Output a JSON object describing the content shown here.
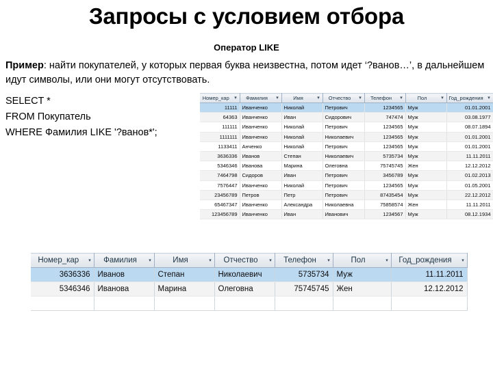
{
  "slide": {
    "title": "Запросы с условием отбора",
    "subtitle": "Оператор LIKE"
  },
  "example": {
    "lead": "Пример",
    "text": ": найти покупателей, у которых первая буква неизвестна, потом идет ‘?ванов…’, в дальнейшем идут символы, или они могут отсутствовать."
  },
  "sql": {
    "line1": "SELECT *",
    "line2": "FROM Покупатель",
    "line3": "WHERE Фамилия LIKE '?ванов*';"
  },
  "icons": {
    "sort_arrow": "▾"
  },
  "source_table": {
    "columns": [
      "Номер_кар",
      "Фамилия",
      "Имя",
      "Отчество",
      "Телефон",
      "Пол",
      "Год_рождения"
    ],
    "rows": [
      [
        "11111",
        "Иванченко",
        "Николай",
        "Петрович",
        "1234565",
        "Муж",
        "01.01.2001"
      ],
      [
        "64363",
        "Иванченко",
        "Иван",
        "Сидорович",
        "747474",
        "Муж",
        "03.08.1977"
      ],
      [
        "111111",
        "Иванченко",
        "Николай",
        "Петрович",
        "1234565",
        "Муж",
        "08.07.1894"
      ],
      [
        "1111111",
        "Иванченко",
        "Николай",
        "Николаевич",
        "1234565",
        "Муж",
        "01.01.2001"
      ],
      [
        "1133411",
        "Анченко",
        "Николай",
        "Петрович",
        "1234565",
        "Муж",
        "01.01.2001"
      ],
      [
        "3636336",
        "Иванов",
        "Степан",
        "Николаевич",
        "5735734",
        "Муж",
        "11.11.2011"
      ],
      [
        "5346346",
        "Иванова",
        "Марина",
        "Олеговна",
        "75745745",
        "Жен",
        "12.12.2012"
      ],
      [
        "7464798",
        "Сидоров",
        "Иван",
        "Петрович",
        "3456789",
        "Муж",
        "01.02.2013"
      ],
      [
        "7576447",
        "Иванченко",
        "Николай",
        "Петрович",
        "1234565",
        "Муж",
        "01.05.2001"
      ],
      [
        "23456789",
        "Петров",
        "Петр",
        "Петрович",
        "87435454",
        "Муж",
        "22.12.2012"
      ],
      [
        "65467347",
        "Иванченко",
        "Александра",
        "Николаевна",
        "75858574",
        "Жен",
        "11.11.2011"
      ],
      [
        "123456789",
        "Иванченко",
        "Иван",
        "Иванович",
        "1234567",
        "Муж",
        "08.12.1934"
      ]
    ],
    "selected_row_index": 0
  },
  "result_table": {
    "columns": [
      "Номер_кар",
      "Фамилия",
      "Имя",
      "Отчество",
      "Телефон",
      "Пол",
      "Год_рождения"
    ],
    "rows": [
      [
        "3636336",
        "Иванов",
        "Степан",
        "Николаевич",
        "5735734",
        "Муж",
        "11.11.2011"
      ],
      [
        "5346346",
        "Иванова",
        "Марина",
        "Олеговна",
        "75745745",
        "Жен",
        "12.12.2012"
      ]
    ],
    "selected_row_index": 0
  },
  "colors": {
    "selection": "#bcd9f2",
    "header_border": "#9fb0c4",
    "alt_row": "#f3f3f3",
    "text": "#000000"
  }
}
